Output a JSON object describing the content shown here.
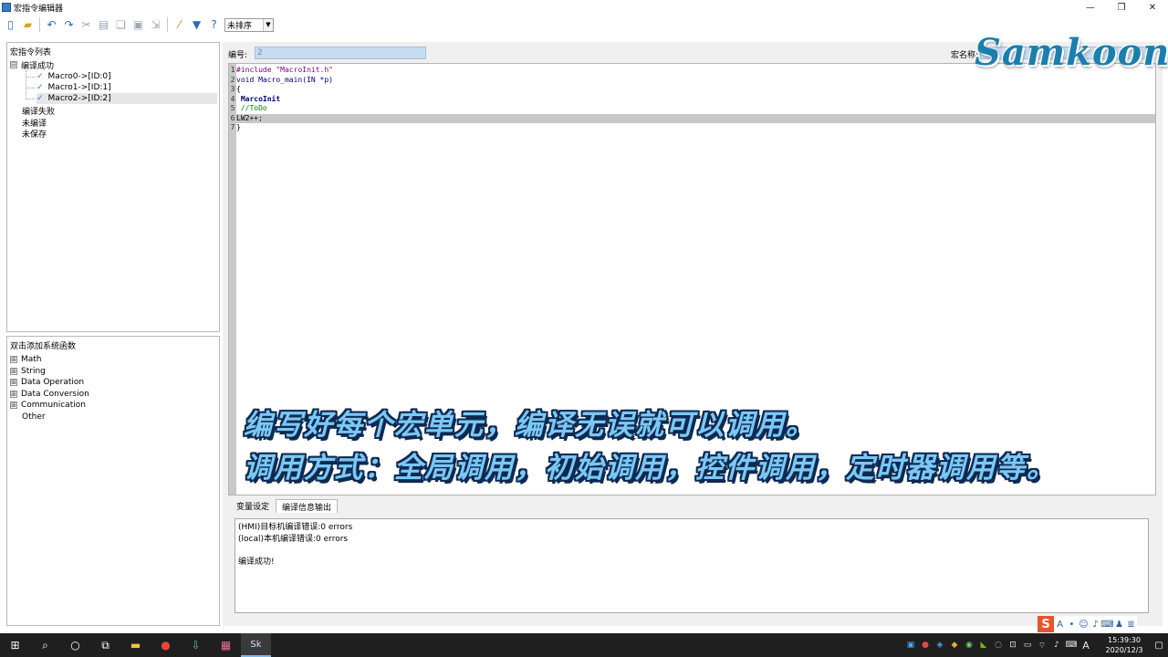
{
  "window": {
    "title": "宏指令编辑器",
    "minimize": "—",
    "restore": "❐",
    "close": "✕"
  },
  "toolbar": {
    "icons": [
      "new-file-icon",
      "open-folder-icon",
      "undo-icon",
      "redo-icon",
      "cut-icon",
      "paste-icon",
      "copy-icon",
      "save-icon",
      "export-icon",
      "compile-wand-icon",
      "filter-icon",
      "help-icon"
    ],
    "sort_value": "未排序",
    "sort_arrow": "▼"
  },
  "macro_list": {
    "heading": "宏指令列表",
    "compiled_group": "编译成功",
    "items": [
      {
        "label": "Macro0->[ID:0]",
        "check": "✓"
      },
      {
        "label": "Macro1->[ID:1]",
        "check": "✓"
      },
      {
        "label": "Macro2->[ID:2]",
        "check": "✓"
      }
    ],
    "failed_group": "编译失败",
    "uncompiled_group": "未编译",
    "unsaved_group": "未保存",
    "expander": "⊟"
  },
  "functions": {
    "heading": "双击添加系统函数",
    "expander": "⊞",
    "items": [
      "Math",
      "String",
      "Data Operation",
      "Data Conversion",
      "Communication"
    ],
    "other": "Other"
  },
  "editor": {
    "id_label": "编号:",
    "id_value": "2",
    "name_label": "宏名称:",
    "lines": [
      {
        "n": "1",
        "a": "#include ",
        "b": "\"MacroInit.h\""
      },
      {
        "n": "2",
        "a": "void Macro_main(IN *p)",
        "b": ""
      },
      {
        "n": "3",
        "a": "{",
        "b": ""
      },
      {
        "n": "4",
        "a": " MarcoInit",
        "b": ""
      },
      {
        "n": "5",
        "a": " //ToDo",
        "b": ""
      },
      {
        "n": "6",
        "a": "LW2++;",
        "b": ""
      },
      {
        "n": "7",
        "a": "}",
        "b": ""
      }
    ]
  },
  "overlay": {
    "brand": "Samkoon",
    "caption_line1": "编写好每个宏单元，编译无误就可以调用。",
    "caption_line2": "调用方式：全局调用，初始调用，控件调用，定时器调用等。"
  },
  "bottom": {
    "tab_vars": "变量设定",
    "tab_output": "编译信息输出",
    "output_lines": [
      "(HMI)目标机编译错误:0 errors",
      "(local)本机编译错误:0 errors",
      "",
      "编译成功!"
    ]
  },
  "ime": {
    "logo": "S",
    "icons": [
      "A",
      "•",
      "☺",
      "♪",
      "⌨",
      "♟",
      "≣"
    ]
  },
  "taskbar": {
    "apps": [
      "windows-start-icon",
      "search-icon",
      "cortana-icon",
      "task-view-icon",
      "file-explorer-icon",
      "chrome-icon",
      "download-icon",
      "app-icon",
      "sk-app-icon"
    ],
    "sk_label": "Sk",
    "time": "15:39:30",
    "date": "2020/12/3",
    "lang": "A"
  },
  "colors": {
    "caption_fill": "#7cc8f4",
    "caption_outline": "#0d2a52",
    "brand": "#1b7fae",
    "id_field": "#c7dcf1"
  }
}
